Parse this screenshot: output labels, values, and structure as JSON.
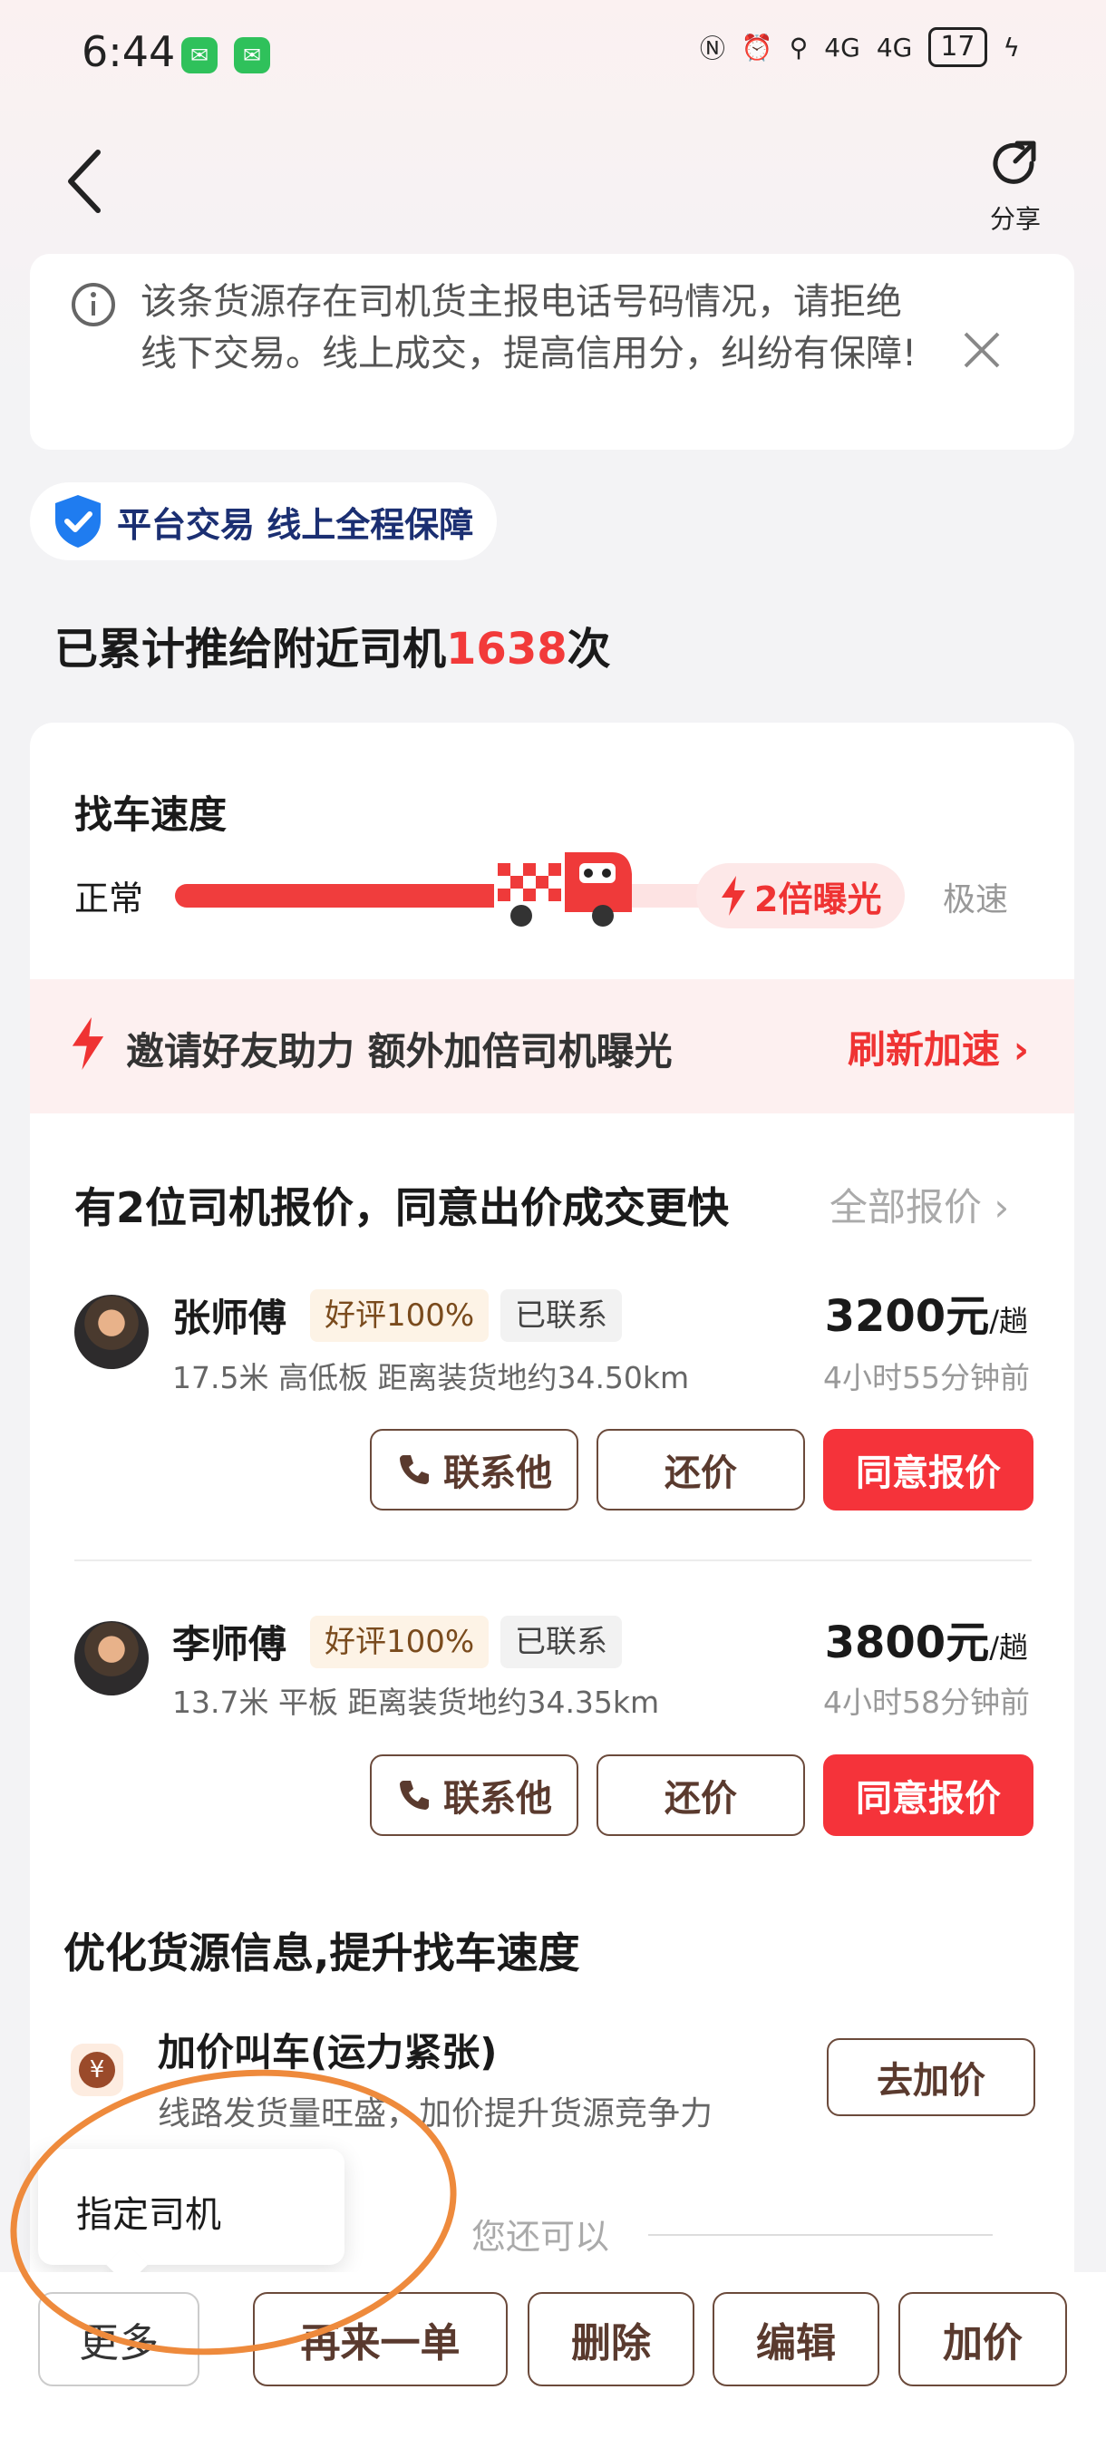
{
  "status_bar": {
    "time": "6:44",
    "battery": "17",
    "network1": "4G",
    "network2": "4G"
  },
  "header": {
    "share_label": "分享"
  },
  "notice": {
    "text": "该条货源存在司机货主报电话号码情况，请拒绝线下交易。线上成交，提高信用分，纠纷有保障!"
  },
  "badge": {
    "text": "平台交易 线上全程保障"
  },
  "push": {
    "prefix": "已累计推给附近司机",
    "count": "1638",
    "suffix": "次"
  },
  "speed": {
    "title": "找车速度",
    "normal": "正常",
    "boost": "2倍曝光",
    "fast": "极速",
    "level": 0.65
  },
  "invite": {
    "text": "邀请好友助力 额外加倍司机曝光",
    "action": "刷新加速"
  },
  "quotes": {
    "title": "有2位司机报价，同意出价成交更快",
    "all_label": "全部报价",
    "drivers": [
      {
        "name": "张师傅",
        "rating": "好评100%",
        "status": "已联系",
        "info": "17.5米 高低板 距离装货地约34.50km",
        "price": "3200元",
        "unit": "/趟",
        "time": "4小时55分钟前",
        "contact": "联系他",
        "counter": "还价",
        "agree": "同意报价"
      },
      {
        "name": "李师傅",
        "rating": "好评100%",
        "status": "已联系",
        "info": "13.7米 平板 距离装货地约34.35km",
        "price": "3800元",
        "unit": "/趟",
        "time": "4小时58分钟前",
        "contact": "联系他",
        "counter": "还价",
        "agree": "同意报价"
      }
    ]
  },
  "optimize": {
    "title": "优化货源信息,提升找车速度",
    "item_name": "加价叫车(运力紧张)",
    "item_desc": "线路发货量旺盛，加价提升货源竞争力",
    "item_button": "去加价",
    "also": "您还可以"
  },
  "popup": {
    "text": "指定司机"
  },
  "bottom_bar": {
    "more": "更多",
    "reorder": "再来一单",
    "delete": "删除",
    "edit": "编辑",
    "raise": "加价"
  },
  "colors": {
    "accent_red": "#f5333a",
    "brand_brown": "#5a3a2e",
    "annotation_orange": "#ee8a3c"
  }
}
